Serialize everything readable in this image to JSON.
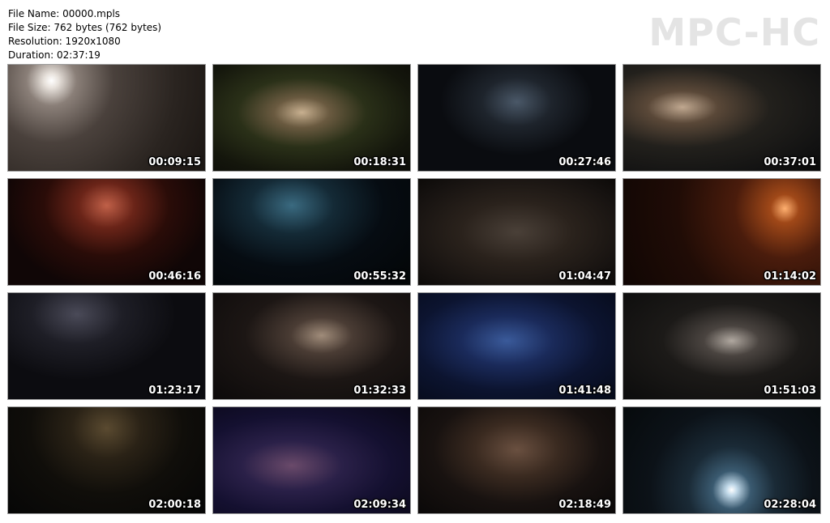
{
  "info": {
    "file_name": "File Name: 00000.mpls",
    "file_size": "File Size: 762 bytes (762 bytes)",
    "resolution": "Resolution: 1920x1080",
    "duration": "Duration: 02:37:19"
  },
  "logo": "MPC-HC",
  "thumbnails": [
    {
      "time": "00:09:15",
      "bg": "radial-gradient(circle at 22% 15%, #ffffff 0%, #e8e2dc 4%, #8a7f78 14%, #4a413c 35%, #2a2420 70%, #1a1512 100%)"
    },
    {
      "time": "00:18:31",
      "bg": "radial-gradient(ellipse at 45% 45%, #c8b090 0%, #6a5a40 18%, #2a3018 42%, #14160c 75%, #0c0c08 100%)"
    },
    {
      "time": "00:27:46",
      "bg": "radial-gradient(ellipse at 50% 35%, #4a5868 0%, #1e242c 25%, #0a0c10 55%), linear-gradient(to bottom, #050608 0%, #101418 60%, #2a2418 80%, #060606 100%)"
    },
    {
      "time": "00:37:01",
      "bg": "radial-gradient(ellipse at 30% 40%, #c0a890 0%, #5a4838 18%, #22201c 45%, #121212 80%, #0a0a0a 100%)"
    },
    {
      "time": "00:46:16",
      "bg": "radial-gradient(ellipse at 50% 25%, #c06048 0%, #6a2418 20%, #2a0c08 45%, #100606 75%), linear-gradient(to bottom, #1a0806 0%, #2a140c 60%, #503418 78%, #0c0606 100%)"
    },
    {
      "time": "00:55:32",
      "bg": "radial-gradient(ellipse at 40% 25%, #3a6a80 0%, #142a36 25%, #060c12 55%, #030506 100%)"
    },
    {
      "time": "01:04:47",
      "bg": "radial-gradient(ellipse at 50% 50%, #4a4038 0%, #2a221c 40%, #161210 80%, #0c0a08 100%)"
    },
    {
      "time": "01:14:02",
      "bg": "radial-gradient(circle at 82% 28%, #ffb070 0%, #a04818 8%, #4a1c0c 28%, #200c06 60%, #100604 100%)"
    },
    {
      "time": "01:23:17",
      "bg": "radial-gradient(ellipse at 35% 20%, #4a4a58 0%, #1e1e26 25%, #0c0c10 55%), linear-gradient(to bottom, #08080a 0%, #141418 60%, #201810 80%, #060606 100%)"
    },
    {
      "time": "01:32:33",
      "bg": "radial-gradient(ellipse at 55% 40%, #a08c7a 0%, #4a3c34 20%, #1c1614 50%, #0c0a0a 100%)"
    },
    {
      "time": "01:41:48",
      "bg": "radial-gradient(ellipse at 45% 45%, #3a5a9a 0%, #1a2a5a 30%, #0c1430 60%, #060a18 100%)"
    },
    {
      "time": "01:51:03",
      "bg": "radial-gradient(ellipse at 55% 45%, #b0a8a0 0%, #4a4440 18%, #1c1a18 45%, #0c0c0c 100%)"
    },
    {
      "time": "02:00:18",
      "bg": "radial-gradient(ellipse at 50% 20%, #5a4a30 0%, #2a2216 25%, #100e0a 55%, #060606 100%)"
    },
    {
      "time": "02:09:34",
      "bg": "radial-gradient(ellipse at 40% 55%, #6a4a6a 0%, #2a2048 30%, #141030 60%, #0a0818 100%)"
    },
    {
      "time": "02:18:49",
      "bg": "radial-gradient(ellipse at 50% 40%, #6a5040 0%, #3a2a20 30%, #181210 60%, #0a0808 100%)"
    },
    {
      "time": "02:28:04",
      "bg": "radial-gradient(circle at 55% 78%, #ffffff 0%, #c0d8e8 4%, #3a5a70 14%, #1a2a36 32%, #0c1218 60%, #060a0c 100%)"
    }
  ]
}
